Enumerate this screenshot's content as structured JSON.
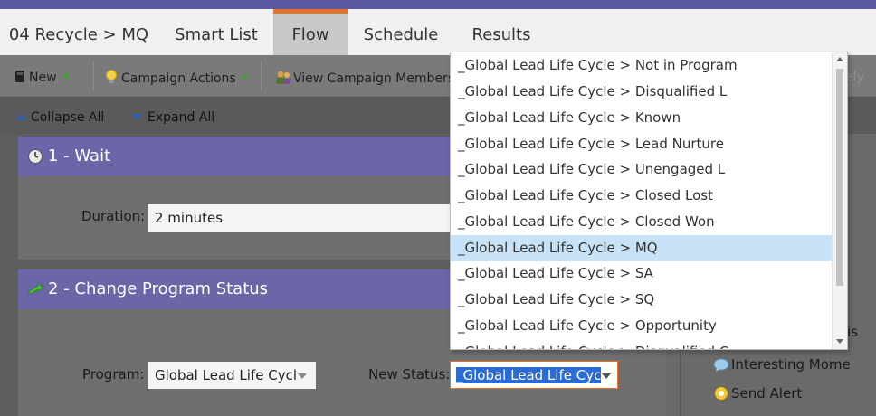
{
  "tabs": [
    {
      "label": "04 Recycle > MQ"
    },
    {
      "label": "Smart List"
    },
    {
      "label": "Flow"
    },
    {
      "label": "Schedule"
    },
    {
      "label": "Results"
    }
  ],
  "toolbar": {
    "new_label": "New",
    "campaign_actions_label": "Campaign Actions",
    "view_members_label": "View Campaign Members",
    "partial_right_label": "ely"
  },
  "subbar": {
    "collapse_label": "Collapse All",
    "expand_label": "Expand All"
  },
  "steps": [
    {
      "title": "1 - Wait",
      "duration_label": "Duration:",
      "duration_value": "2 minutes"
    },
    {
      "title": "2 - Change Program Status",
      "program_label": "Program:",
      "program_value": "Global Lead Life Cycl",
      "new_status_label": "New Status:",
      "new_status_value": "_Global Lead Life Cyc"
    }
  ],
  "right_panel": {
    "partial_label": "is",
    "items": [
      {
        "label": "Interesting Mome",
        "icon": "chat-bubble-icon"
      },
      {
        "label": "Send Alert",
        "icon": "alert-icon"
      }
    ]
  },
  "dropdown": {
    "options": [
      "_Global Lead Life Cycle > Not in Program",
      "_Global Lead Life Cycle > Disqualified L",
      "_Global Lead Life Cycle > Known",
      "_Global Lead Life Cycle > Lead Nurture",
      "_Global Lead Life Cycle > Unengaged L",
      "_Global Lead Life Cycle > Closed Lost",
      "_Global Lead Life Cycle > Closed Won",
      "_Global Lead Life Cycle > MQ",
      "_Global Lead Life Cycle > SA",
      "_Global Lead Life Cycle > SQ",
      "_Global Lead Life Cycle > Opportunity",
      "_Global Lead Life Cycle > Disqualified C"
    ],
    "selected_index": 7
  },
  "colors": {
    "accent_purple": "#6a66a8",
    "active_tab_orange": "#e8732a",
    "selection_blue": "#c8e3f7"
  }
}
